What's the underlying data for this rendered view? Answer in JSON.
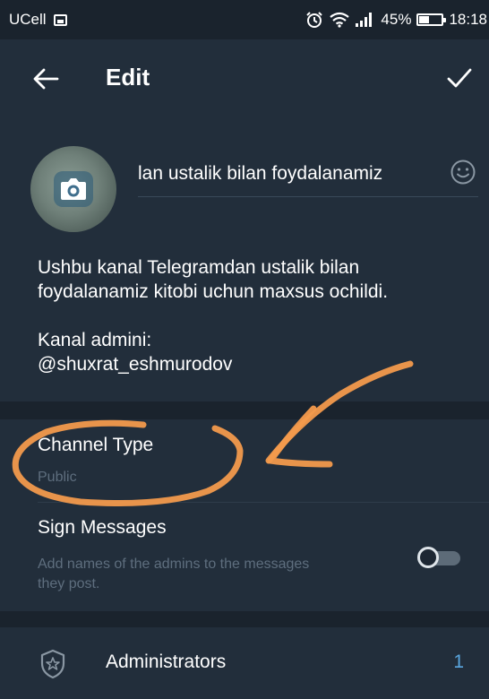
{
  "status_bar": {
    "carrier": "UCell",
    "battery_text": "45%",
    "battery_level": 0.45,
    "time": "18:18",
    "icons": [
      "alarm-icon",
      "wifi-icon",
      "signal-icon",
      "battery-icon"
    ]
  },
  "app_bar": {
    "title": "Edit",
    "back_icon": "arrow-left-icon",
    "done_icon": "checkmark-icon"
  },
  "channel": {
    "name_value": "lan ustalik bilan foydalanamiz",
    "description_paragraphs": [
      "Ushbu kanal Telegramdan ustalik bilan\nfoydalanamiz kitobi uchun maxsus ochildi.",
      "Kanal admini:\n@shuxrat_eshmurodov"
    ]
  },
  "settings": {
    "channel_type": {
      "title": "Channel Type",
      "value": "Public"
    },
    "sign_messages": {
      "title": "Sign Messages",
      "description": "Add names of the admins to the messages\nthey post.",
      "enabled": false
    }
  },
  "administrators": {
    "label": "Administrators",
    "count": "1"
  },
  "colors": {
    "background": "#1d2733",
    "panel": "#222e3b",
    "accent": "#5aa7e0",
    "annotation": "#f39a4c"
  }
}
